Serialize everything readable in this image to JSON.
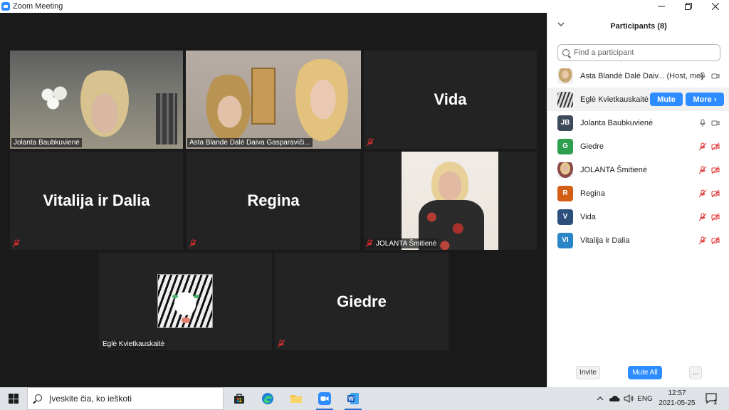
{
  "window": {
    "title": "Zoom Meeting",
    "minimize_icon": "minimize-icon",
    "restore_icon": "restore-icon",
    "close_icon": "close-icon"
  },
  "gallery": {
    "tiles": [
      {
        "name": "Jolanta Baubkuvienė",
        "type": "video"
      },
      {
        "name": "Asta Blandė Dalė Daiva Gasparaviči...",
        "type": "video",
        "active_speaker": true
      },
      {
        "name": "Vida",
        "type": "name",
        "muted": true
      },
      {
        "name": "Vitalija ir Dalia",
        "type": "name",
        "muted": true
      },
      {
        "name": "Regina",
        "type": "name",
        "muted": true
      },
      {
        "name": "JOLANTA Šmitienė",
        "type": "photo",
        "muted": true
      },
      {
        "name": "Eglė Kvietkauskaitė",
        "type": "photo"
      },
      {
        "name": "Giedre",
        "type": "name",
        "muted": true
      }
    ],
    "active_speaker_color": "#b5e04a"
  },
  "participants": {
    "header": "Participants (8)",
    "collapse_icon": "chevron-down-icon",
    "search_placeholder": "Find a participant",
    "list": [
      {
        "initials": "",
        "name": "Asta Blandė Dalė Daiv...",
        "note": "(Host, me)",
        "mic": "on",
        "video": "on"
      },
      {
        "initials": "",
        "name": "Eglė Kvietkauskaitė",
        "mute_label": "Mute",
        "more_label": "More ›"
      },
      {
        "initials": "JB",
        "name": "Jolanta Baubkuvienė",
        "mic": "on",
        "video": "on",
        "color": "#3d4a5c"
      },
      {
        "initials": "G",
        "name": "Giedre",
        "mic": "muted",
        "video": "off",
        "color": "#2e9e4f"
      },
      {
        "initials": "",
        "name": "JOLANTA Šmitienė",
        "mic": "muted",
        "video": "off"
      },
      {
        "initials": "R",
        "name": "Regina",
        "mic": "muted",
        "video": "off",
        "color": "#d35f16"
      },
      {
        "initials": "V",
        "name": "Vida",
        "mic": "muted",
        "video": "off",
        "color": "#2c4f7c"
      },
      {
        "initials": "VI",
        "name": "Vitalija ir Dalia",
        "mic": "muted",
        "video": "off",
        "color": "#2a85c6"
      }
    ],
    "footer": {
      "invite": "Invite",
      "mute_all": "Mute All",
      "more": "..."
    }
  },
  "taskbar": {
    "search_placeholder": "Įveskite čia, ko ieškoti",
    "apps": [
      "store-icon",
      "edge-icon",
      "file-explorer-icon",
      "zoom-icon",
      "word-icon"
    ],
    "language": "ENG",
    "time": "12:57",
    "date": "2021-05-25",
    "notification_count": "1"
  },
  "colors": {
    "accent": "#2d8cff",
    "muted_red": "#e02f2f"
  }
}
